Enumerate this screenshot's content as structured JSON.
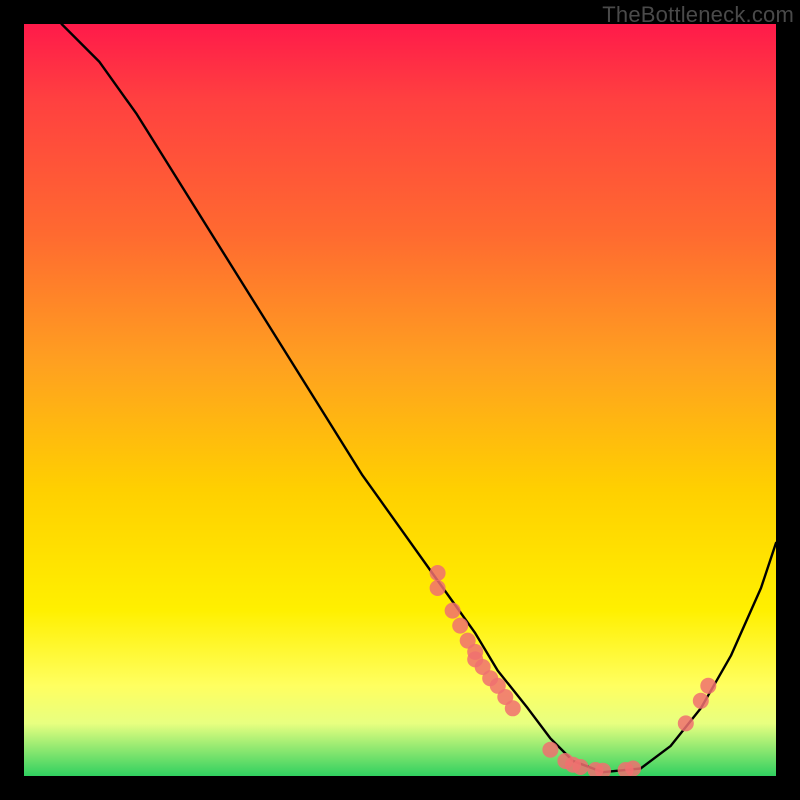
{
  "watermark": "TheBottleneck.com",
  "chart_data": {
    "type": "line",
    "title": "",
    "xlabel": "",
    "ylabel": "",
    "xlim": [
      0,
      100
    ],
    "ylim": [
      0,
      100
    ],
    "grid": false,
    "legend": false,
    "series": [
      {
        "name": "curve",
        "x": [
          5,
          10,
          15,
          20,
          25,
          30,
          35,
          40,
          45,
          50,
          55,
          60,
          63,
          67,
          70,
          73,
          77,
          82,
          86,
          90,
          94,
          98,
          100
        ],
        "y": [
          100,
          95,
          88,
          80,
          72,
          64,
          56,
          48,
          40,
          33,
          26,
          19,
          14,
          9,
          5,
          2,
          0.5,
          1,
          4,
          9,
          16,
          25,
          31
        ],
        "stroke": "#000000"
      }
    ],
    "markers": [
      {
        "x": 55,
        "y": 27,
        "color": "#f07070"
      },
      {
        "x": 55,
        "y": 25,
        "color": "#f07070"
      },
      {
        "x": 57,
        "y": 22,
        "color": "#f07070"
      },
      {
        "x": 58,
        "y": 20,
        "color": "#f07070"
      },
      {
        "x": 59,
        "y": 18,
        "color": "#f07070"
      },
      {
        "x": 60,
        "y": 16.5,
        "color": "#f07070"
      },
      {
        "x": 60,
        "y": 15.5,
        "color": "#f07070"
      },
      {
        "x": 61,
        "y": 14.5,
        "color": "#f07070"
      },
      {
        "x": 62,
        "y": 13,
        "color": "#f07070"
      },
      {
        "x": 63,
        "y": 12,
        "color": "#f07070"
      },
      {
        "x": 64,
        "y": 10.5,
        "color": "#f07070"
      },
      {
        "x": 65,
        "y": 9,
        "color": "#f07070"
      },
      {
        "x": 70,
        "y": 3.5,
        "color": "#f07070"
      },
      {
        "x": 72,
        "y": 2,
        "color": "#f07070"
      },
      {
        "x": 73,
        "y": 1.5,
        "color": "#f07070"
      },
      {
        "x": 74,
        "y": 1.2,
        "color": "#f07070"
      },
      {
        "x": 76,
        "y": 0.8,
        "color": "#f07070"
      },
      {
        "x": 77,
        "y": 0.7,
        "color": "#f07070"
      },
      {
        "x": 80,
        "y": 0.8,
        "color": "#f07070"
      },
      {
        "x": 81,
        "y": 1.0,
        "color": "#f07070"
      },
      {
        "x": 88,
        "y": 7,
        "color": "#f07070"
      },
      {
        "x": 90,
        "y": 10,
        "color": "#f07070"
      },
      {
        "x": 91,
        "y": 12,
        "color": "#f07070"
      }
    ]
  }
}
